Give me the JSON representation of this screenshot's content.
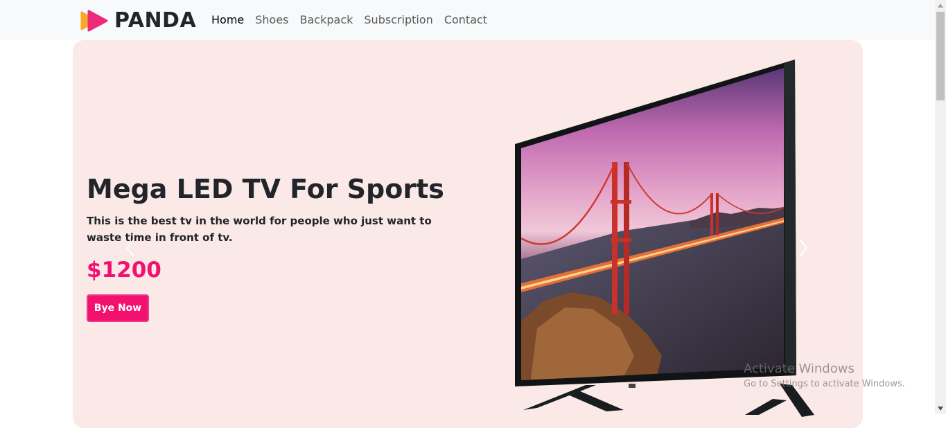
{
  "nav": {
    "brand": "PANDA",
    "links": [
      "Home",
      "Shoes",
      "Backpack",
      "Subscription",
      "Contact"
    ]
  },
  "hero": {
    "title": "Mega LED TV For Sports",
    "description": "This is the best tv in the world for people who just want to waste time in front of tv.",
    "price": "$1200",
    "cta": "Bye Now"
  },
  "watermark": {
    "title": "Activate Windows",
    "subtitle": "Go to Settings to activate Windows."
  },
  "colors": {
    "accent": "#f2116e",
    "hero_bg": "#fbe9e8",
    "logo_orange": "#f7a928",
    "logo_pink": "#ee2a7b"
  },
  "icons": [
    "panda-logo-icon",
    "chevron-left-icon",
    "chevron-right-icon",
    "tv-product-image"
  ]
}
